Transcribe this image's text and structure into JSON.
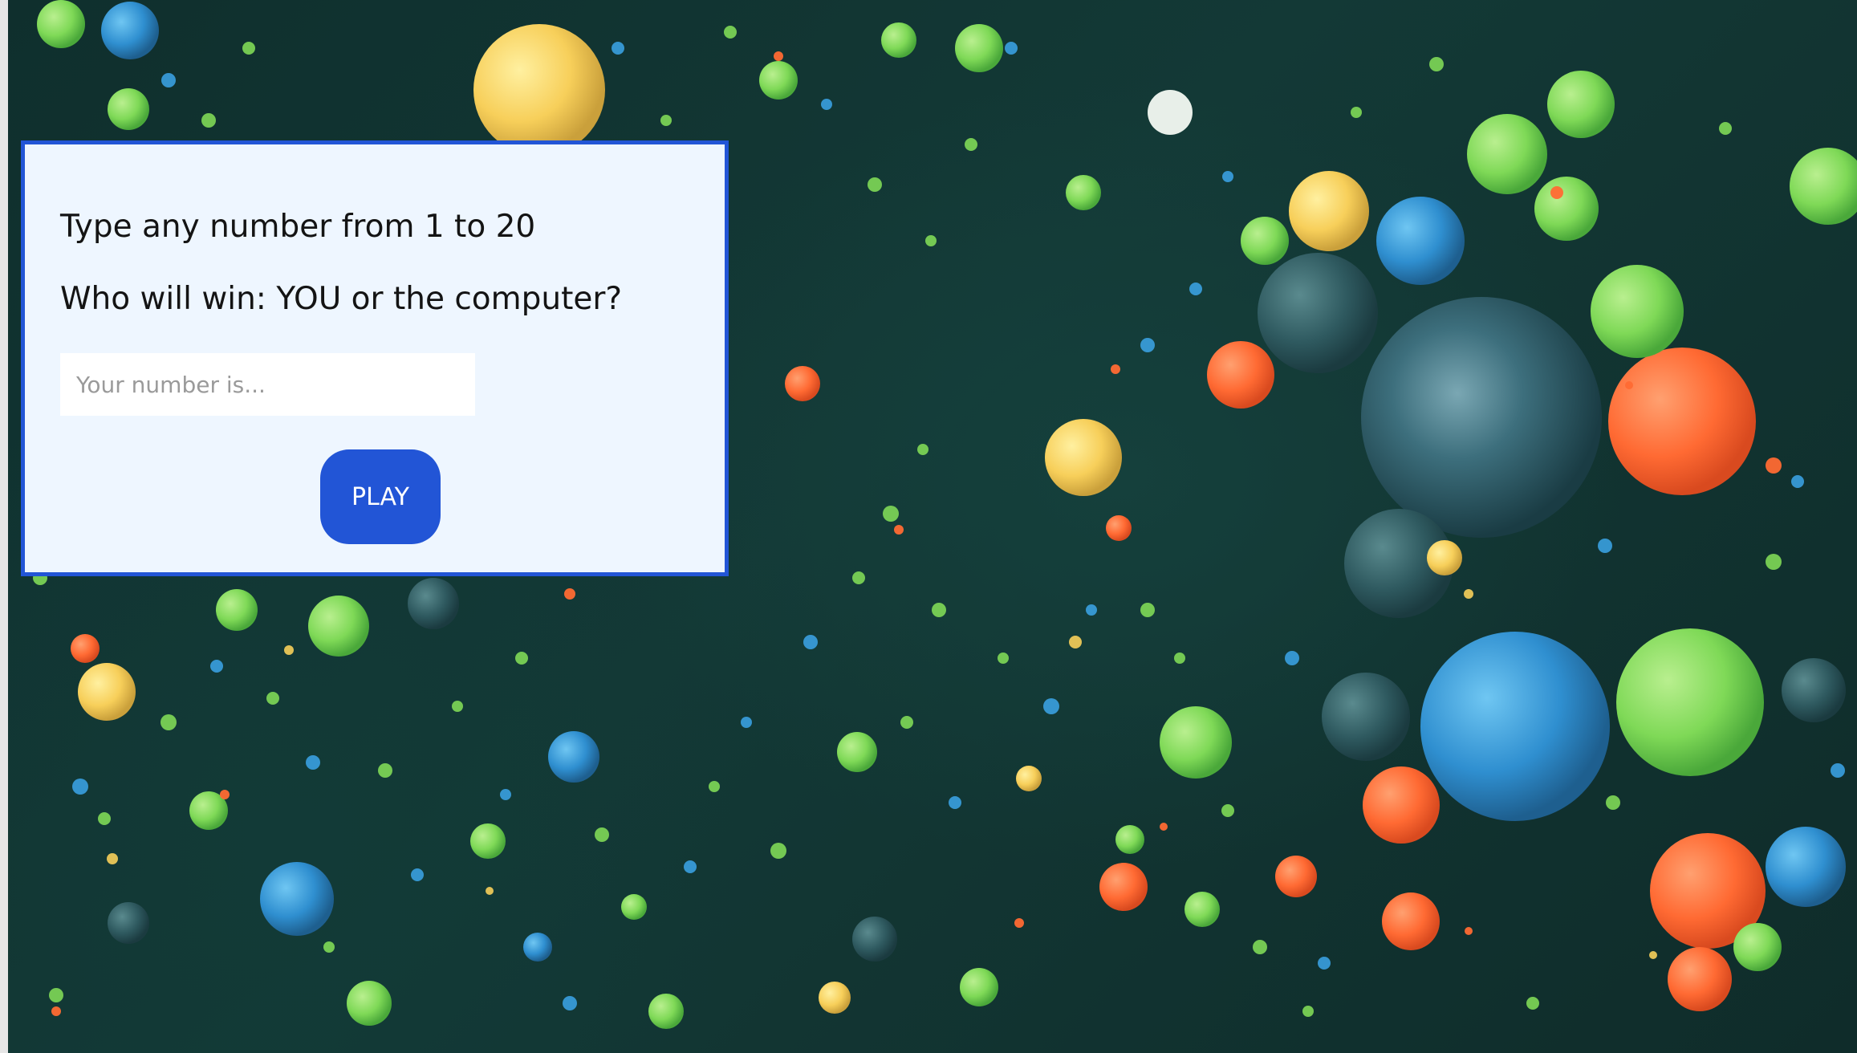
{
  "game": {
    "instruction": "Type any number from 1 to 20",
    "question": "Who will win: YOU or the computer?",
    "input_placeholder": "Your number is...",
    "input_value": "",
    "play_label": "PLAY"
  },
  "colors": {
    "accent": "#2255d6",
    "card_background": "#eef6ff",
    "page_background": "#10322f"
  },
  "background_image": "colorful-paint-bubbles"
}
